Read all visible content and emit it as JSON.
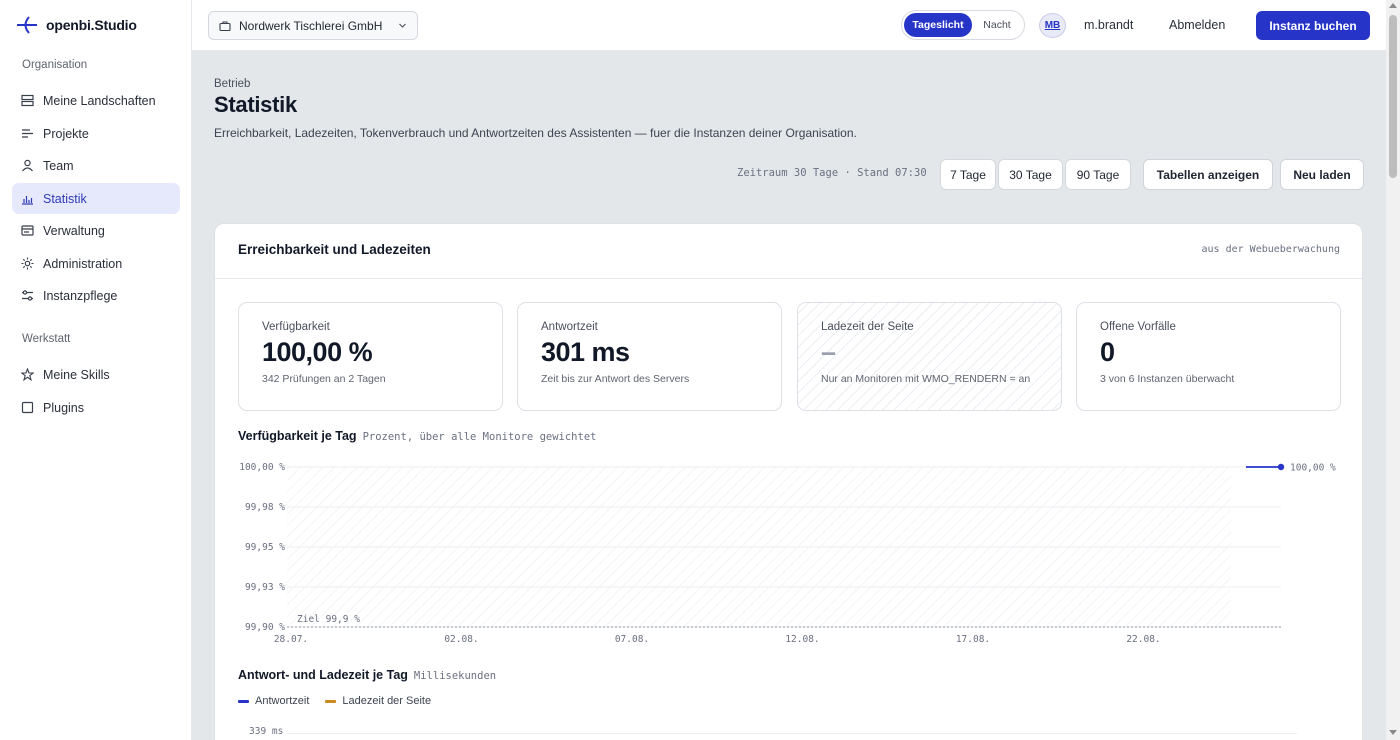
{
  "app": {
    "name": "openbi.Studio"
  },
  "sidebar": {
    "sections": [
      {
        "title": "Organisation",
        "items": [
          {
            "label": "Meine Landschaften",
            "icon": "landscapes-icon",
            "active": false
          },
          {
            "label": "Projekte",
            "icon": "projects-icon",
            "active": false
          },
          {
            "label": "Team",
            "icon": "team-icon",
            "active": false
          },
          {
            "label": "Statistik",
            "icon": "chart-icon",
            "active": true
          },
          {
            "label": "Verwaltung",
            "icon": "admin-panel-icon",
            "active": false
          },
          {
            "label": "Administration",
            "icon": "gear-icon",
            "active": false
          },
          {
            "label": "Instanzpflege",
            "icon": "sliders-icon",
            "active": false
          }
        ]
      },
      {
        "title": "Werkstatt",
        "items": [
          {
            "label": "Meine Skills",
            "icon": "star-icon",
            "active": false
          },
          {
            "label": "Plugins",
            "icon": "plugin-icon",
            "active": false
          }
        ]
      }
    ]
  },
  "topbar": {
    "org_selector": "Nordwerk Tischlerei GmbH",
    "theme_light": "Tageslicht",
    "theme_dark": "Nacht",
    "avatar_initials": "MB",
    "username": "m.brandt",
    "logout": "Abmelden",
    "book_button": "Instanz buchen"
  },
  "header": {
    "eyebrow": "Betrieb",
    "title": "Statistik",
    "description": "Erreichbarkeit, Ladezeiten, Tokenverbrauch und Antwortzeiten des Assistenten — fuer die Instanzen deiner Organisation.",
    "period_info": "Zeitraum 30 Tage · Stand 07:30",
    "ranges": [
      "7 Tage",
      "30 Tage",
      "90 Tage"
    ],
    "tables_button": "Tabellen anzeigen",
    "reload_button": "Neu laden"
  },
  "card": {
    "title": "Erreichbarkeit und Ladezeiten",
    "source": "aus der Webueberwachung",
    "kpis": [
      {
        "label": "Verfügbarkeit",
        "value": "100,00 %",
        "sub": "342 Prüfungen an 2 Tagen",
        "hatched": false
      },
      {
        "label": "Antwortzeit",
        "value": "301 ms",
        "sub": "Zeit bis zur Antwort des Servers",
        "hatched": false
      },
      {
        "label": "Ladezeit der Seite",
        "value": "–",
        "sub": "Nur an Monitoren mit WMO_RENDERN = an",
        "hatched": true
      },
      {
        "label": "Offene Vorfälle",
        "value": "0",
        "sub": "3 von 6 Instanzen überwacht",
        "hatched": false
      }
    ],
    "availability_section": {
      "title": "Verfügbarkeit je Tag",
      "hint": "Prozent, über alle Monitore gewichtet"
    },
    "response_section": {
      "title": "Antwort- und Ladezeit je Tag",
      "hint": "Millisekunden"
    },
    "legend": [
      {
        "label": "Antwortzeit",
        "color": "#2634c8"
      },
      {
        "label": "Ladezeit der Seite",
        "color": "#c98a1e"
      }
    ],
    "response_axis_top": "339 ms"
  },
  "chart_data": {
    "type": "line",
    "title": "Verfügbarkeit je Tag",
    "subtitle": "Prozent, über alle Monitore gewichtet",
    "y_ticks": [
      "100,00 %",
      "99,98 %",
      "99,95 %",
      "99,93 %",
      "99,90 %"
    ],
    "x_ticks": [
      "28.07.",
      "02.08.",
      "07.08.",
      "12.08.",
      "17.08.",
      "22.08."
    ],
    "ylim": [
      99.9,
      100.0
    ],
    "target_line": {
      "label": "Ziel 99,9 %",
      "value": 99.9
    },
    "series": [
      {
        "color": "#2634c8",
        "points": [
          {
            "x": "25.08.",
            "y": 100.0
          }
        ],
        "end_label": "100,00 %"
      }
    ],
    "grid": true
  }
}
